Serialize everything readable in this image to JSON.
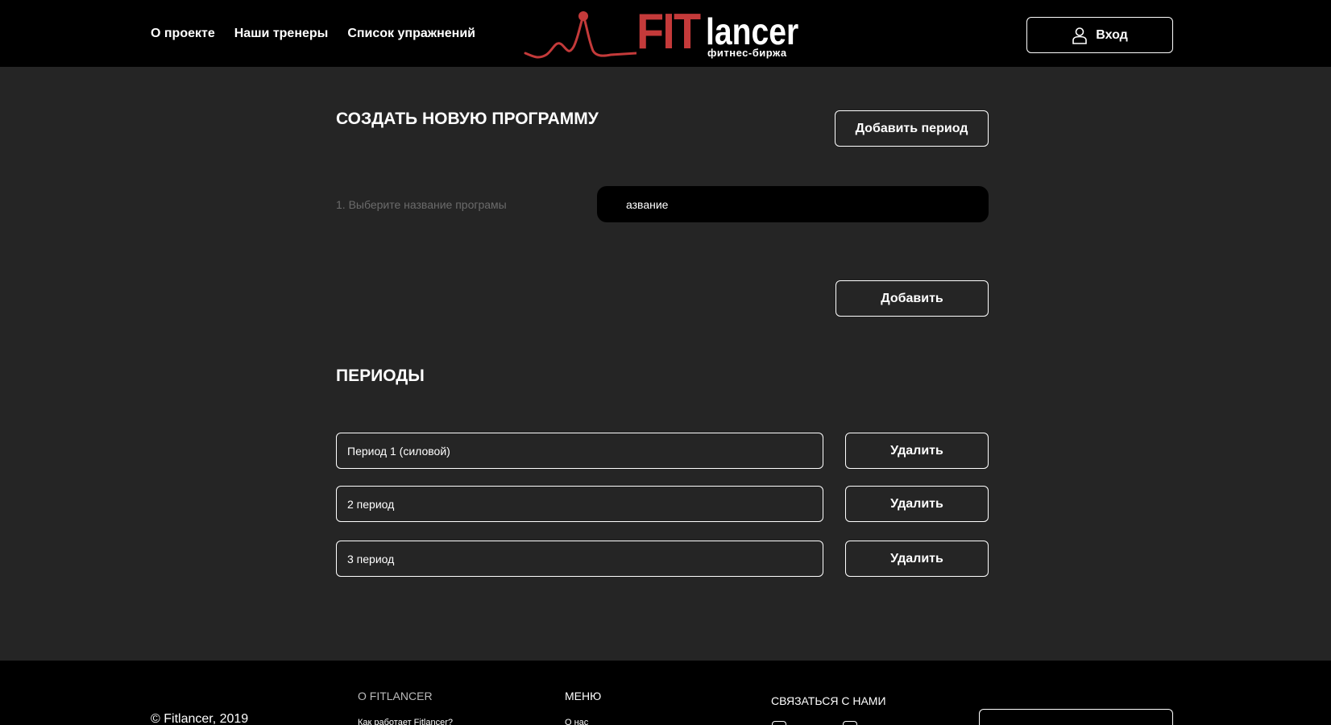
{
  "nav": {
    "items": [
      "О проекте",
      "Наши тренеры",
      "Список упражнений"
    ]
  },
  "logo": {
    "fit": "FIT",
    "lancer": "lancer",
    "subtitle": "фитнес-биржа"
  },
  "login": {
    "label": "Вход"
  },
  "main": {
    "title": "СОЗДАТЬ НОВУЮ ПРОГРАММУ",
    "add_period_label": "Добавить период",
    "field_label": "1. Выберите название програмы",
    "name_value": "азвание",
    "add_label": "Добавить",
    "periods_title": "ПЕРИОДЫ",
    "periods": [
      {
        "name": "Период 1 (силовой)",
        "delete_label": "Удалить"
      },
      {
        "name": "2 период",
        "delete_label": "Удалить"
      },
      {
        "name": "3 период",
        "delete_label": "Удалить"
      }
    ]
  },
  "footer": {
    "copyright": "© Fitlancer, 2019",
    "about_title": "О FITLANCER",
    "about_link": "Как работает Fitlancer?",
    "menu_title": "МЕНЮ",
    "menu_link": "О нас",
    "contact_title": "СВЯЗАТЬСЯ С НАМИ"
  },
  "colors": {
    "accent": "#c43a3a",
    "background": "#252525",
    "header": "#000000"
  },
  "icons": [
    "user-icon",
    "heartbeat-logo-icon",
    "instagram-icon",
    "telegram-icon",
    "social-icon"
  ]
}
